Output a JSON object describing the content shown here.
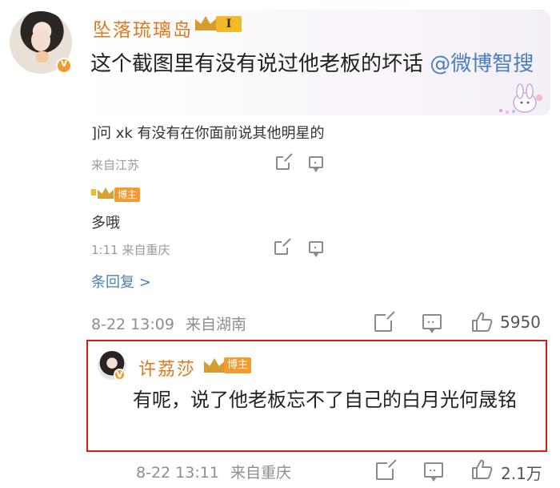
{
  "top_comment": {
    "username": "坠落琉璃岛",
    "level_badge": "I",
    "text_before_mention": "这个截图里有没有说过他老板的坏话 ",
    "mention": "@微博智搜"
  },
  "sub_replies": {
    "reply1_text": "]问 xk 有没有在你面前说其他明星的",
    "reply1_meta": "来自江苏",
    "reply2_boss_tag": "博主",
    "reply2_text": "多哦",
    "reply2_meta": "1:11  来自重庆",
    "more_replies_label": "条回复 >"
  },
  "top_comment_meta": {
    "timestamp": "8-22 13:09",
    "location": "来自湖南",
    "like_count": "5950"
  },
  "highlighted_reply": {
    "username": "许荔莎",
    "boss_tag": "博主",
    "text": "有呢，说了他老板忘不了自己的白月光何晟铭",
    "timestamp": "8-22 13:11",
    "location": "来自重庆",
    "like_count": "2.1万"
  },
  "icons": [
    "share-icon",
    "comment-icon",
    "thumbs-up-icon",
    "crown-icon",
    "verified-icon"
  ],
  "colors": {
    "username": "#e0781e",
    "mention": "#4a7fc1",
    "highlight_border": "#d61a1a",
    "boss_tag": "#f39b2e"
  }
}
